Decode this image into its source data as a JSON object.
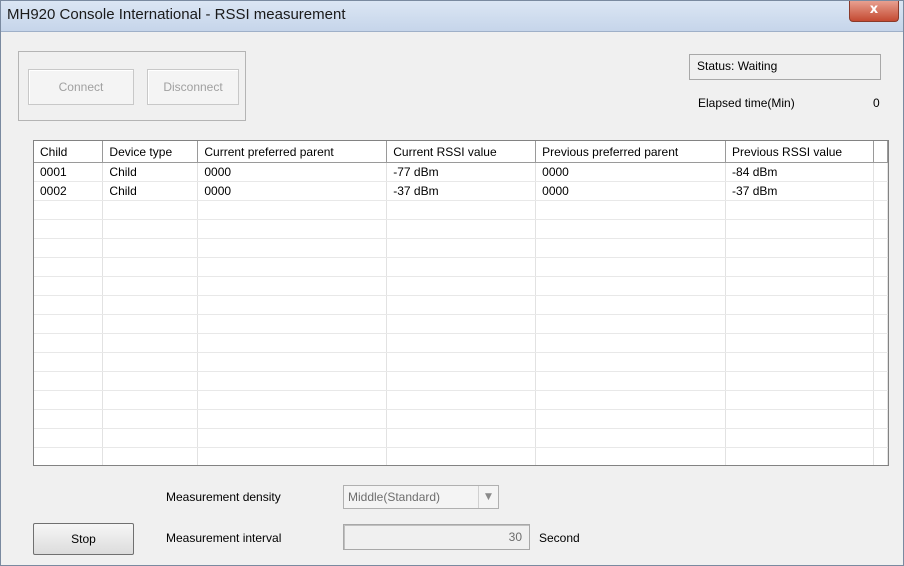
{
  "window": {
    "title": "MH920 Console International - RSSI measurement",
    "close_glyph": "x"
  },
  "connection": {
    "connect_label": "Connect",
    "disconnect_label": "Disconnect"
  },
  "status": {
    "text": "Status: Waiting",
    "elapsed_label": "Elapsed time(Min)",
    "elapsed_value": "0"
  },
  "table": {
    "columns": [
      "Child",
      "Device type",
      "Current preferred parent",
      "Current RSSI value",
      "Previous preferred parent",
      "Previous RSSI value"
    ],
    "rows": [
      [
        "0001",
        "Child",
        "0000",
        "-77 dBm",
        "0000",
        "-84 dBm"
      ],
      [
        "0002",
        "Child",
        "0000",
        "-37 dBm",
        "0000",
        "-37 dBm"
      ]
    ],
    "empty_rows": 14
  },
  "controls": {
    "stop_label": "Stop",
    "density_label": "Measurement density",
    "density_value": "Middle(Standard)",
    "interval_label": "Measurement interval",
    "interval_value": "30",
    "interval_unit": "Second"
  },
  "icons": {
    "combo_arrow": "chevron-down-icon"
  }
}
